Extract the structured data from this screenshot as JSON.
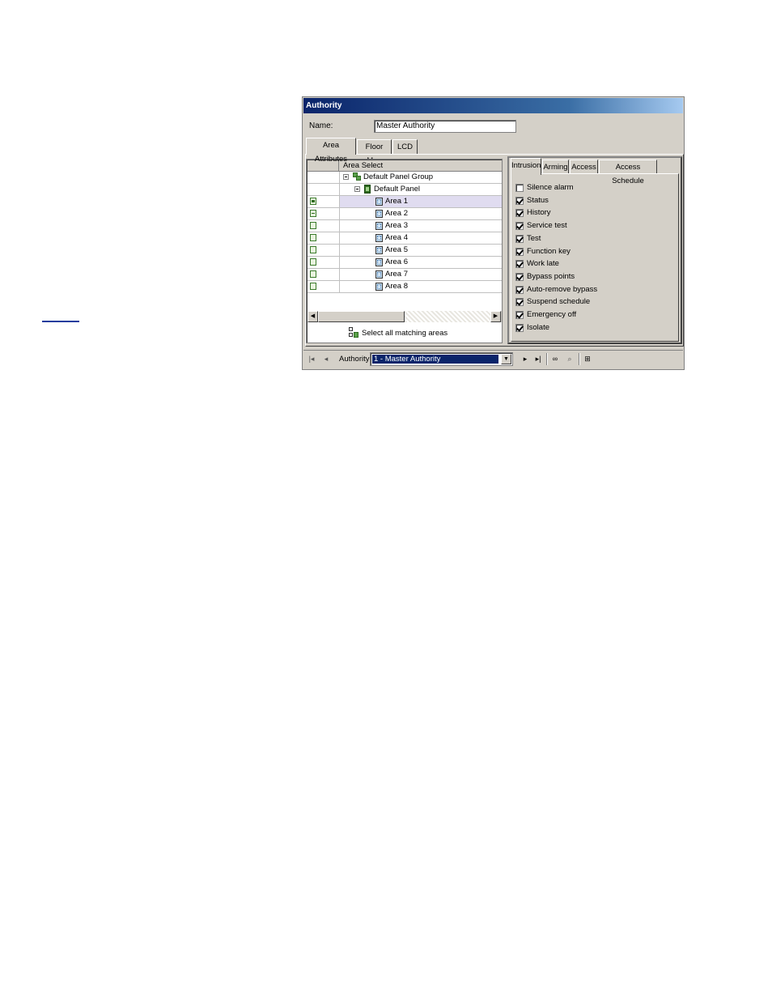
{
  "window": {
    "title": "Authority"
  },
  "name_field": {
    "label": "Name:",
    "value": "Master Authority"
  },
  "main_tabs": [
    {
      "label": "Area Attributes",
      "active": true
    },
    {
      "label": "Floor Map",
      "active": false
    },
    {
      "label": "LCD",
      "active": false
    }
  ],
  "area_grid": {
    "header": "Area Select",
    "group": "Default Panel Group",
    "panel": "Default Panel",
    "areas": [
      {
        "label": "Area 1",
        "status": "plus",
        "selected": true
      },
      {
        "label": "Area 2",
        "status": "minus",
        "selected": false
      },
      {
        "label": "Area 3",
        "status": "empty",
        "selected": false
      },
      {
        "label": "Area 4",
        "status": "empty",
        "selected": false
      },
      {
        "label": "Area 5",
        "status": "empty",
        "selected": false
      },
      {
        "label": "Area 6",
        "status": "empty",
        "selected": false
      },
      {
        "label": "Area 7",
        "status": "empty",
        "selected": false
      },
      {
        "label": "Area 8",
        "status": "empty",
        "selected": false
      }
    ],
    "select_all_label": "Select all matching areas"
  },
  "permission_tabs": [
    {
      "label": "Intrusion",
      "active": true
    },
    {
      "label": "Arming",
      "active": false
    },
    {
      "label": "Access",
      "active": false
    },
    {
      "label": "Access Schedule",
      "active": false
    }
  ],
  "intrusion_permissions": [
    {
      "label": "Silence alarm",
      "checked": false
    },
    {
      "label": "Status",
      "checked": true
    },
    {
      "label": "History",
      "checked": true
    },
    {
      "label": "Service test",
      "checked": true
    },
    {
      "label": "Test",
      "checked": true
    },
    {
      "label": "Function key",
      "checked": true
    },
    {
      "label": "Work late",
      "checked": true
    },
    {
      "label": "Bypass points",
      "checked": true
    },
    {
      "label": "Auto-remove bypass",
      "checked": true
    },
    {
      "label": "Suspend schedule",
      "checked": true
    },
    {
      "label": "Emergency off",
      "checked": true
    },
    {
      "label": "Isolate",
      "checked": true
    }
  ],
  "navigator": {
    "label": "Authority",
    "selected_value": "1 - Master Authority"
  },
  "colors": {
    "title_bar": "#0a246a",
    "window_bg": "#d4d0c8",
    "selected_row": "#e0dcf0",
    "page_link": "#1f3d9e"
  }
}
